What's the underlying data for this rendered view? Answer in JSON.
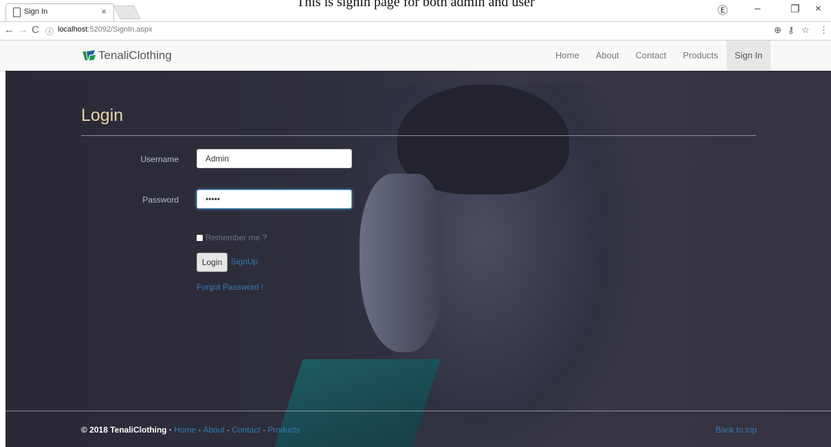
{
  "caption": "This is signin page for both admin and user",
  "browser": {
    "tab_title": "Sign In",
    "tab_close": "×",
    "url_host": "localhost",
    "url_path": ":52092/SignIn.aspx",
    "win_minimize": "–",
    "win_restore": "❐",
    "win_close": "×"
  },
  "site": {
    "brand": "TenaliClothing",
    "nav": [
      {
        "label": "Home"
      },
      {
        "label": "About"
      },
      {
        "label": "Contact"
      },
      {
        "label": "Products"
      },
      {
        "label": "Sign In"
      }
    ]
  },
  "login": {
    "title": "Login",
    "username_label": "Username",
    "username_value": "Admin",
    "password_label": "Password",
    "password_value": "•••••",
    "remember_label": "Remember me ?",
    "login_button": "Login",
    "signup_link": "SignUp",
    "forgot_link": "Forgot Password !"
  },
  "footer": {
    "copyright": "© 2018 TenaliClothing · ",
    "links": [
      "Home",
      "About",
      "Contact",
      "Products"
    ],
    "sep": " · ",
    "back_to_top": "Back to top"
  }
}
